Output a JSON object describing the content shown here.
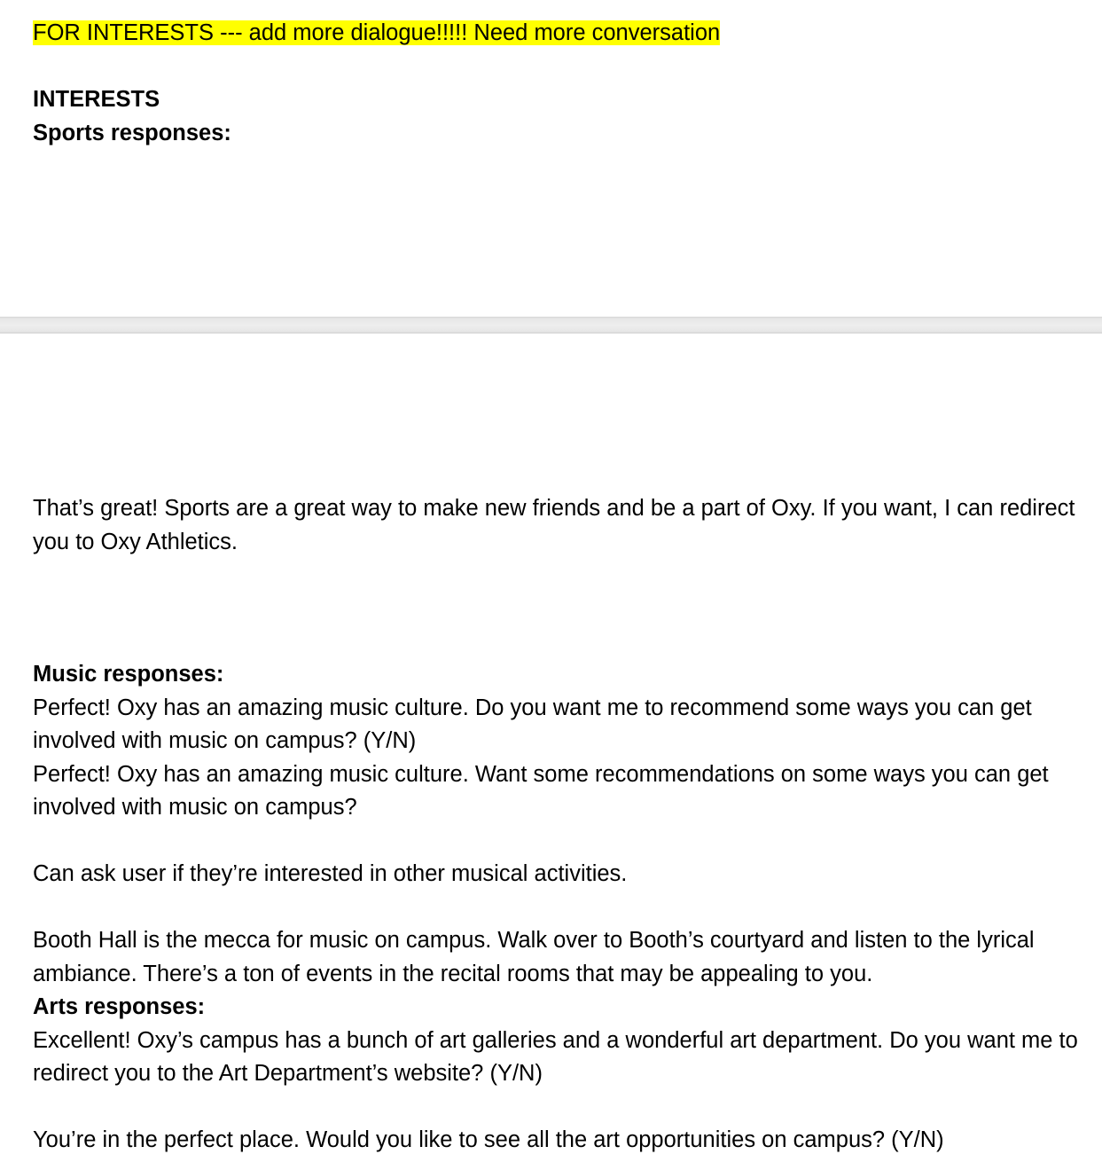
{
  "page_top": {
    "note": "FOR INTERESTS --- add more dialogue!!!!! Need more conversation",
    "heading": "INTERESTS",
    "sports_heading": "Sports responses:"
  },
  "page_bottom": {
    "sports_response": "That’s great! Sports are a great way to make new friends and be a part of Oxy. If you want, I can redirect you to Oxy Athletics.",
    "music_heading": "Music responses:",
    "music_response_1": "Perfect! Oxy has an amazing music culture. Do you want me to recommend some ways you can get involved with music on campus? (Y/N)",
    "music_response_2": "Perfect! Oxy has an amazing music culture. Want some recommendations on some ways you can get involved with music on campus?",
    "music_note": "Can ask user if they’re interested in other musical activities.",
    "music_booth": "Booth Hall is the mecca for music on campus. Walk over to Booth’s courtyard and listen to the lyrical ambiance. There’s a ton of events in the recital rooms that may be appealing to you.",
    "arts_heading": "Arts responses:",
    "arts_response_1": "Excellent! Oxy’s campus has a bunch of art galleries and a wonderful art department. Do you want me to redirect you to the Art Department’s website? (Y/N)",
    "arts_response_2": "You’re in the perfect place. Would you like to see all the art opportunities on campus? (Y/N)"
  },
  "colors": {
    "highlight": "#ffff00",
    "text": "#000000",
    "page_gap": "#e8e8e8"
  }
}
